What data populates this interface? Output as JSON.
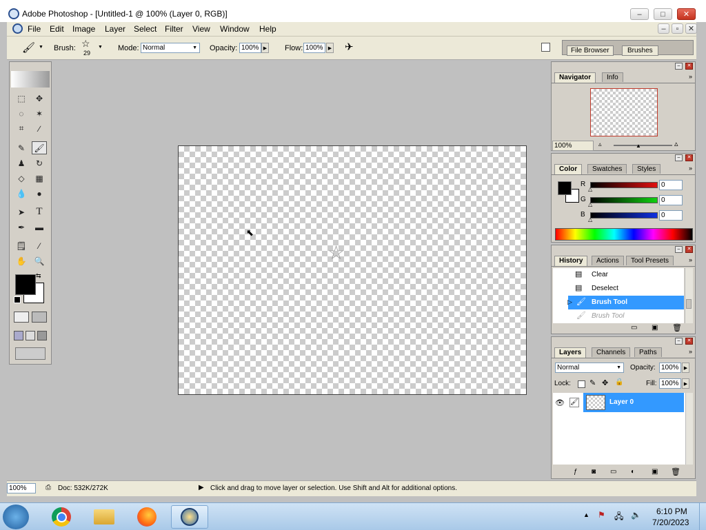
{
  "window": {
    "title": "Adobe Photoshop - [Untitled-1 @ 100% (Layer 0, RGB)]",
    "min": "–",
    "max": "□",
    "close": "✕",
    "doc_min": "–",
    "doc_max": "▫",
    "doc_close": "✕"
  },
  "menu": [
    "File",
    "Edit",
    "Image",
    "Layer",
    "Select",
    "Filter",
    "View",
    "Window",
    "Help"
  ],
  "options": {
    "brush_label": "Brush:",
    "brush_size": "29",
    "mode_label": "Mode:",
    "mode_value": "Normal",
    "opacity_label": "Opacity:",
    "opacity_value": "100%",
    "flow_label": "Flow:",
    "flow_value": "100%",
    "well_tabs": [
      "File Browser",
      "Brushes"
    ]
  },
  "navigator": {
    "tabs": [
      "Navigator",
      "Info"
    ],
    "zoom": "100%"
  },
  "color": {
    "tabs": [
      "Color",
      "Swatches",
      "Styles"
    ],
    "channels": [
      {
        "label": "R",
        "value": "0",
        "color": "#cc1010"
      },
      {
        "label": "G",
        "value": "0",
        "color": "#10b010"
      },
      {
        "label": "B",
        "value": "0",
        "color": "#1020cc"
      }
    ]
  },
  "history": {
    "tabs": [
      "History",
      "Actions",
      "Tool Presets"
    ],
    "items": [
      {
        "label": "Clear",
        "state": "normal"
      },
      {
        "label": "Deselect",
        "state": "normal"
      },
      {
        "label": "Brush Tool",
        "state": "selected"
      },
      {
        "label": "Brush Tool",
        "state": "dimmed"
      }
    ]
  },
  "layers": {
    "tabs": [
      "Layers",
      "Channels",
      "Paths"
    ],
    "blend_mode": "Normal",
    "opacity_label": "Opacity:",
    "opacity_value": "100%",
    "lock_label": "Lock:",
    "fill_label": "Fill:",
    "fill_value": "100%",
    "layer_name": "Layer 0"
  },
  "status": {
    "zoom": "100%",
    "doc": "Doc: 532K/272K",
    "hint": "Click and drag to move layer or selection.  Use Shift and Alt for additional options."
  },
  "taskbar": {
    "time": "6:10 PM",
    "date": "7/20/2023"
  },
  "colors": {
    "accent": "#3399ff",
    "foreground": "#000000",
    "background": "#ffffff"
  }
}
